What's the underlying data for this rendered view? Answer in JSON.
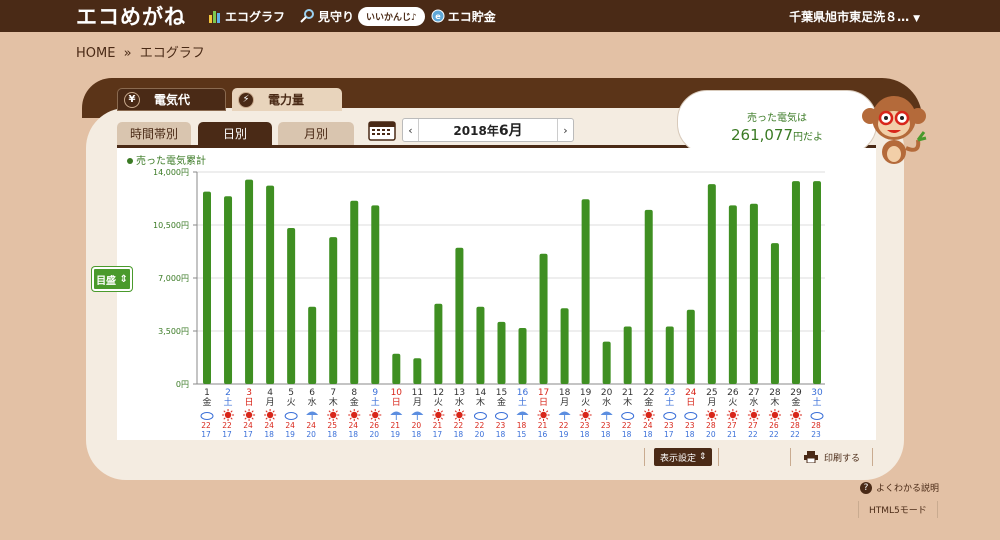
{
  "header": {
    "logo": "エコめがね",
    "nav": [
      {
        "label": "エコグラフ",
        "icon": "bar-chart-icon"
      },
      {
        "label": "見守り",
        "icon": "magnifier-icon",
        "bubble": "いいかんじ♪"
      },
      {
        "label": "エコ貯金",
        "icon": "coin-icon"
      }
    ],
    "region": "千葉県旭市東足洗８…"
  },
  "breadcrumb": {
    "home": "HOME",
    "sep": "»",
    "current": "エコグラフ"
  },
  "tabs": {
    "denki": "電気代",
    "denryoku": "電力量",
    "denki_icon": "¥",
    "denryoku_icon": "⚡"
  },
  "subtabs": {
    "time": "時間帯別",
    "day": "日別",
    "month": "月別"
  },
  "date": {
    "year": "2018年",
    "month": "6月"
  },
  "bubble": {
    "line1": "売った電気は",
    "value": "261,077",
    "unit": "円だよ"
  },
  "ybutton": "目盛",
  "bottom": {
    "settings": "表示設定",
    "print": "印刷する",
    "help": "よくわかる説明",
    "html5": "HTML5モード"
  },
  "colors": {
    "bar": "#3f8f22",
    "sat": "#3a6fd8",
    "sun": "#d8261a",
    "weekday": "#333333"
  },
  "chart_data": {
    "type": "bar",
    "legend": [
      "売った電気累計"
    ],
    "ylim": [
      0,
      14000
    ],
    "yticks": [
      "14,000円",
      "10,500円",
      "7,000円",
      "3,500円",
      "0円"
    ],
    "ytick_values": [
      14000,
      10500,
      7000,
      3500,
      0
    ],
    "categories": [
      "1",
      "2",
      "3",
      "4",
      "5",
      "6",
      "7",
      "8",
      "9",
      "10",
      "11",
      "12",
      "13",
      "14",
      "15",
      "16",
      "17",
      "18",
      "19",
      "20",
      "21",
      "22",
      "23",
      "24",
      "25",
      "26",
      "27",
      "28",
      "29",
      "30"
    ],
    "weekdays": [
      "金",
      "土",
      "日",
      "月",
      "火",
      "水",
      "木",
      "金",
      "土",
      "日",
      "月",
      "火",
      "水",
      "木",
      "金",
      "土",
      "日",
      "月",
      "火",
      "水",
      "木",
      "金",
      "土",
      "日",
      "月",
      "火",
      "水",
      "木",
      "金",
      "土"
    ],
    "values": [
      12700,
      12400,
      13500,
      13100,
      10300,
      5100,
      9700,
      12100,
      11800,
      2000,
      1700,
      5300,
      9000,
      5100,
      4100,
      3700,
      8600,
      5000,
      12200,
      2800,
      3800,
      11500,
      3800,
      4900,
      13200,
      11800,
      11900,
      9300,
      13400,
      13400
    ],
    "weather": [
      "cloudy",
      "sun",
      "sun",
      "sun",
      "cloudy",
      "rain",
      "sun",
      "sun",
      "sun",
      "rain",
      "rain",
      "sun",
      "sun",
      "cloudy",
      "cloudy",
      "rain",
      "sun",
      "rain",
      "sun",
      "rain",
      "cloudy",
      "sun",
      "cloudy",
      "cloudy",
      "sun",
      "sun",
      "sun",
      "sun",
      "sun",
      "cloudy"
    ],
    "high": [
      22,
      22,
      24,
      24,
      24,
      24,
      25,
      24,
      26,
      21,
      20,
      21,
      22,
      22,
      23,
      18,
      21,
      22,
      23,
      23,
      22,
      24,
      23,
      23,
      28,
      27,
      27,
      26,
      28,
      28
    ],
    "low": [
      17,
      17,
      17,
      18,
      19,
      20,
      18,
      18,
      20,
      19,
      18,
      17,
      18,
      20,
      18,
      15,
      16,
      19,
      18,
      18,
      18,
      18,
      17,
      18,
      20,
      21,
      22,
      22,
      22,
      23
    ]
  }
}
